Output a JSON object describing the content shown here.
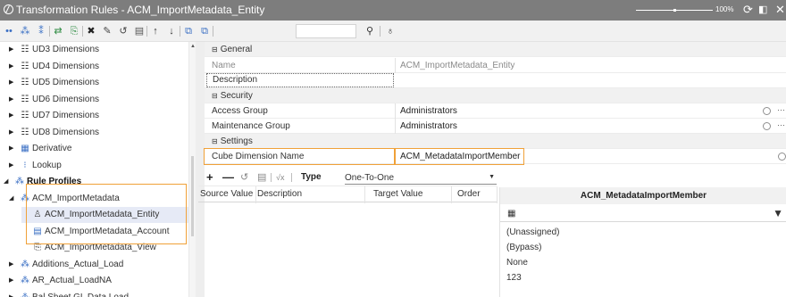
{
  "window": {
    "title": "Transformation Rules - ACM_ImportMetadata_Entity",
    "zoom": "100%",
    "icons": [
      "refresh-icon",
      "restore-window-icon",
      "close-icon"
    ]
  },
  "toolbar": {
    "search_value": ""
  },
  "tree": [
    {
      "label": "UD3 Dimensions",
      "icon": "ud3-icon",
      "expander": "▶",
      "level": 1
    },
    {
      "label": "UD4 Dimensions",
      "icon": "ud4-icon",
      "expander": "▶",
      "level": 1
    },
    {
      "label": "UD5 Dimensions",
      "icon": "ud5-icon",
      "expander": "▶",
      "level": 1
    },
    {
      "label": "UD6 Dimensions",
      "icon": "ud6-icon",
      "expander": "▶",
      "level": 1
    },
    {
      "label": "UD7 Dimensions",
      "icon": "ud7-icon",
      "expander": "▶",
      "level": 1
    },
    {
      "label": "UD8 Dimensions",
      "icon": "ud8-icon",
      "expander": "▶",
      "level": 1
    },
    {
      "label": "Derivative",
      "icon": "derivative-icon",
      "expander": "▶",
      "level": 1
    },
    {
      "label": "Lookup",
      "icon": "lookup-icon",
      "expander": "▶",
      "level": 1
    },
    {
      "label": "Rule Profiles",
      "icon": "profiles-icon",
      "expander": "◢",
      "level": 0,
      "bold": true
    },
    {
      "label": "ACM_ImportMetadata",
      "icon": "profile-icon",
      "expander": "◢",
      "level": 1
    },
    {
      "label": "ACM_ImportMetadata_Entity",
      "icon": "entity-rule-icon",
      "expander": "",
      "level": 2,
      "selected": true
    },
    {
      "label": "ACM_ImportMetadata_Account",
      "icon": "account-rule-icon",
      "expander": "",
      "level": 2
    },
    {
      "label": "ACM_ImportMetadata_View",
      "icon": "view-rule-icon",
      "expander": "",
      "level": 2
    },
    {
      "label": "Additions_Actual_Load",
      "icon": "profile-icon",
      "expander": "▶",
      "level": 1
    },
    {
      "label": "AR_Actual_LoadNA",
      "icon": "profile-icon",
      "expander": "▶",
      "level": 1
    },
    {
      "label": "Bal Sheet GL Data Load",
      "icon": "profile-icon",
      "expander": "▶",
      "level": 1
    }
  ],
  "properties": {
    "general": {
      "header": "General",
      "name_label": "Name",
      "name_value": "ACM_ImportMetadata_Entity",
      "description_label": "Description",
      "description_value": ""
    },
    "security": {
      "header": "Security",
      "access_label": "Access Group",
      "access_value": "Administrators",
      "maintenance_label": "Maintenance Group",
      "maintenance_value": "Administrators"
    },
    "settings": {
      "header": "Settings",
      "cube_label": "Cube Dimension Name",
      "cube_value": "ACM_MetadataImportMember"
    }
  },
  "edit": {
    "type_label": "Type",
    "type_value": "One-To-One"
  },
  "grid": {
    "columns": [
      "Source Value",
      "Description",
      "Target Value",
      "Order"
    ],
    "rows": []
  },
  "member_panel": {
    "title": "ACM_MetadataImportMember",
    "filter_value": "",
    "items": [
      "(Unassigned)",
      "(Bypass)",
      "None",
      "123"
    ]
  },
  "colors": {
    "highlight": "#f0a138",
    "titlebar": "#7d7d7d",
    "selection": "#e6eaf6"
  }
}
